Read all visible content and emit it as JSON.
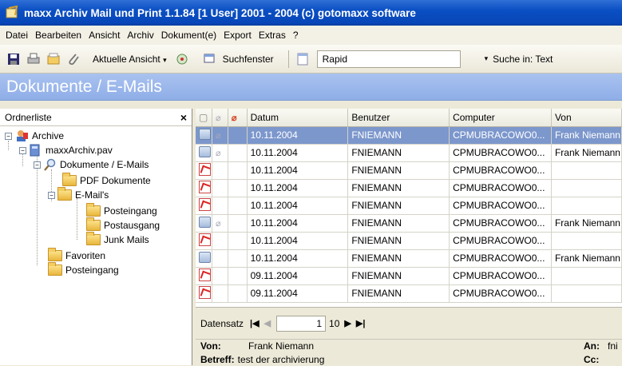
{
  "window": {
    "title": "maxx Archiv Mail und Print 1.1.84 [1 User] 2001 - 2004 (c) gotomaxx software"
  },
  "menu": [
    "Datei",
    "Bearbeiten",
    "Ansicht",
    "Archiv",
    "Dokument(e)",
    "Export",
    "Extras",
    "?"
  ],
  "toolbar": {
    "view_label": "Aktuelle Ansicht",
    "search_window_label": "Suchfenster",
    "search_value": "Rapid",
    "search_in_label": "Suche in: Text"
  },
  "banner": {
    "title": "Dokumente / E-Mails"
  },
  "folders": {
    "header": "Ordnerliste",
    "close": "×",
    "items": [
      "Archive",
      "maxxArchiv.pav",
      "Dokumente / E-Mails",
      "PDF Dokumente",
      "E-Mail's",
      "Posteingang",
      "Postausgang",
      "Junk Mails",
      "Favoriten",
      "Posteingang"
    ]
  },
  "table": {
    "columns": [
      "Datum",
      "Benutzer",
      "Computer",
      "Von"
    ],
    "rows": [
      {
        "type": "mail",
        "attach": true,
        "datum": "10.11.2004",
        "benutzer": "FNIEMANN",
        "computer": "CPMUBRACOWO0...",
        "von": "Frank Niemann"
      },
      {
        "type": "mail",
        "attach": true,
        "datum": "10.11.2004",
        "benutzer": "FNIEMANN",
        "computer": "CPMUBRACOWO0...",
        "von": "Frank Niemann"
      },
      {
        "type": "pdf",
        "attach": false,
        "datum": "10.11.2004",
        "benutzer": "FNIEMANN",
        "computer": "CPMUBRACOWO0...",
        "von": ""
      },
      {
        "type": "pdf",
        "attach": false,
        "datum": "10.11.2004",
        "benutzer": "FNIEMANN",
        "computer": "CPMUBRACOWO0...",
        "von": ""
      },
      {
        "type": "pdf",
        "attach": false,
        "datum": "10.11.2004",
        "benutzer": "FNIEMANN",
        "computer": "CPMUBRACOWO0...",
        "von": ""
      },
      {
        "type": "mail",
        "attach": true,
        "datum": "10.11.2004",
        "benutzer": "FNIEMANN",
        "computer": "CPMUBRACOWO0...",
        "von": "Frank Niemann"
      },
      {
        "type": "pdf",
        "attach": false,
        "datum": "10.11.2004",
        "benutzer": "FNIEMANN",
        "computer": "CPMUBRACOWO0...",
        "von": ""
      },
      {
        "type": "mail",
        "attach": false,
        "datum": "10.11.2004",
        "benutzer": "FNIEMANN",
        "computer": "CPMUBRACOWO0...",
        "von": "Frank Niemann"
      },
      {
        "type": "pdf",
        "attach": false,
        "datum": "09.11.2004",
        "benutzer": "FNIEMANN",
        "computer": "CPMUBRACOWO0...",
        "von": ""
      },
      {
        "type": "pdf",
        "attach": false,
        "datum": "09.11.2004",
        "benutzer": "FNIEMANN",
        "computer": "CPMUBRACOWO0...",
        "von": ""
      }
    ]
  },
  "navigation": {
    "label": "Datensatz",
    "current": "1",
    "total": "10"
  },
  "preview": {
    "from_label": "Von:",
    "from_value": "Frank Niemann",
    "subject_label": "Betreff:",
    "subject_value": "test der archivierung",
    "to_label": "An:",
    "to_value": "fni",
    "cc_label": "Cc:"
  },
  "colors": {
    "titlebar": "#0a4fc4",
    "banner": "#94b2e9",
    "selection": "#7c97cc"
  }
}
